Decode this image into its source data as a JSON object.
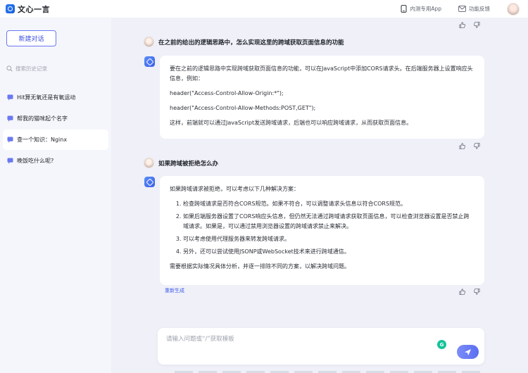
{
  "app": {
    "brand": "文心一言",
    "topbar": {
      "beta_app_label": "内测专用App",
      "feedback_label": "功能反馈"
    }
  },
  "sidebar": {
    "new_chat_label": "新建对话",
    "search_placeholder": "搜索历史记录",
    "history": [
      {
        "label": "Hit算无氧还是有氧运动",
        "active": false
      },
      {
        "label": "帮我的猫咪起个名字",
        "active": false
      },
      {
        "label": "查一个知识：Nginx",
        "active": true
      },
      {
        "label": "晚饭吃什么呢?",
        "active": false
      }
    ]
  },
  "conversation": {
    "turns": [
      {
        "question": "在之前的给出的逻辑思路中，怎么实现这里的跨域获取页面信息的功能",
        "answer": {
          "paragraphs": [
            "要在之前的逻辑思路中实现跨域获取页面信息的功能，可以在JavaScript中添加CORS请求头。在后端服务器上设置响应头信息，例如：",
            "header(\"Access-Control-Allow-Origin:*\");",
            "header(\"Access-Control-Allow-Methods:POST,GET\");",
            "这样，前端就可以通过JavaScript发送跨域请求，后端也可以响应跨域请求，从而获取页面信息。"
          ]
        }
      },
      {
        "question": "如果跨域被拒绝怎么办",
        "answer": {
          "intro": "如果跨域请求被拒绝，可以考虑以下几种解决方案：",
          "list": [
            "检查跨域请求是否符合CORS规范。如果不符合，可以调整请求头信息以符合CORS规范。",
            "如果后端服务器设置了CORS响应头信息，但仍然无法通过跨域请求获取页面信息，可以检查浏览器设置是否禁止跨域请求。如果是，可以通过禁用浏览器设置的跨域请求禁止来解决。",
            "可以考虑使用代理服务器来转发跨域请求。",
            "另外，还可以尝试使用JSONP或WebSocket技术来进行跨域通信。"
          ],
          "outro": "需要根据实际情况具体分析，并逐一排除不同的方案，以解决跨域问题。"
        },
        "regenerate_label": "重新生成"
      }
    ]
  },
  "input": {
    "placeholder": "请输入问题或“/”获取模板",
    "grammarly_glyph": "G"
  },
  "colors": {
    "accent": "#3d4fe0",
    "sidebar_bg": "#f5f6fb",
    "main_bg": "#eff0f8",
    "grammarly": "#15c39a"
  },
  "icons": {
    "brand": "wenxin-logo-icon",
    "phone": "phone-icon",
    "mail": "mail-icon",
    "search": "search-icon",
    "chat": "chat-bubble-icon",
    "like": "thumbs-up-icon",
    "dislike": "thumbs-down-icon",
    "send": "send-icon"
  }
}
